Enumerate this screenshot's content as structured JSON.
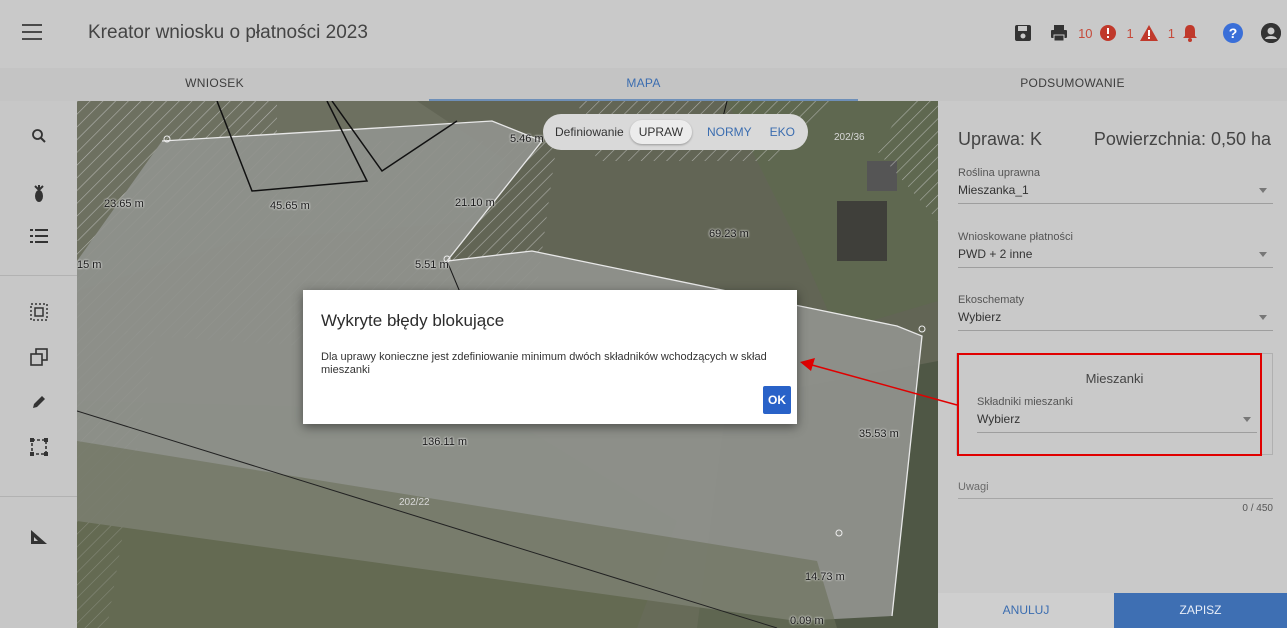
{
  "header": {
    "title": "Kreator wniosku o płatności 2023",
    "error_count": "10",
    "warning_count": "1",
    "notification_count": "1",
    "icons": [
      "save-icon",
      "print-icon",
      "error-icon",
      "warning-icon",
      "bell-icon",
      "help-icon",
      "user-icon"
    ]
  },
  "tabs": [
    {
      "label": "WNIOSEK",
      "active": false
    },
    {
      "label": "MAPA",
      "active": true
    },
    {
      "label": "PODSUMOWANIE",
      "active": false
    }
  ],
  "left_tools": [
    "search-icon",
    "plant-icon",
    "list-icon",
    "select-parcel-icon",
    "copy-icon",
    "edit-icon",
    "select-area-icon",
    "measure-icon"
  ],
  "map": {
    "mode_label": "Definiowanie",
    "modes": [
      {
        "label": "UPRAW",
        "active": true
      },
      {
        "label": "NORMY",
        "active": false
      },
      {
        "label": "EKO",
        "active": false
      }
    ],
    "measurements": [
      "5.46 m",
      "23.65 m",
      "45.65 m",
      "21.10 m",
      "69.23 m",
      "15 m",
      "5.51 m",
      "136.11 m",
      "35.53 m",
      "14.73 m",
      "0.09 m"
    ],
    "parcel_ids": [
      "202/36",
      "202/22"
    ]
  },
  "panel": {
    "title": "Uprawa: K",
    "area": "Powierzchnia: 0,50 ha",
    "fields": [
      {
        "label": "Roślina uprawna",
        "value": "Mieszanka_1"
      },
      {
        "label": "Wnioskowane płatności",
        "value": "PWD + 2 inne"
      },
      {
        "label": "Ekoschematy",
        "value": "Wybierz"
      }
    ],
    "mix": {
      "title": "Mieszanki",
      "label": "Składniki mieszanki",
      "value": "Wybierz"
    },
    "notes_placeholder": "Uwagi",
    "notes_counter": "0 / 450",
    "cancel_label": "ANULUJ",
    "save_label": "ZAPISZ"
  },
  "dialog": {
    "title": "Wykryte błędy blokujące",
    "message": "Dla uprawy konieczne jest zdefiniowanie minimum dwóch składników wchodzących w skład mieszanki",
    "ok_label": "OK"
  },
  "colors": {
    "accent": "#3e6fb3",
    "error_badge": "#c0392b",
    "annotation_red": "#e00000"
  }
}
